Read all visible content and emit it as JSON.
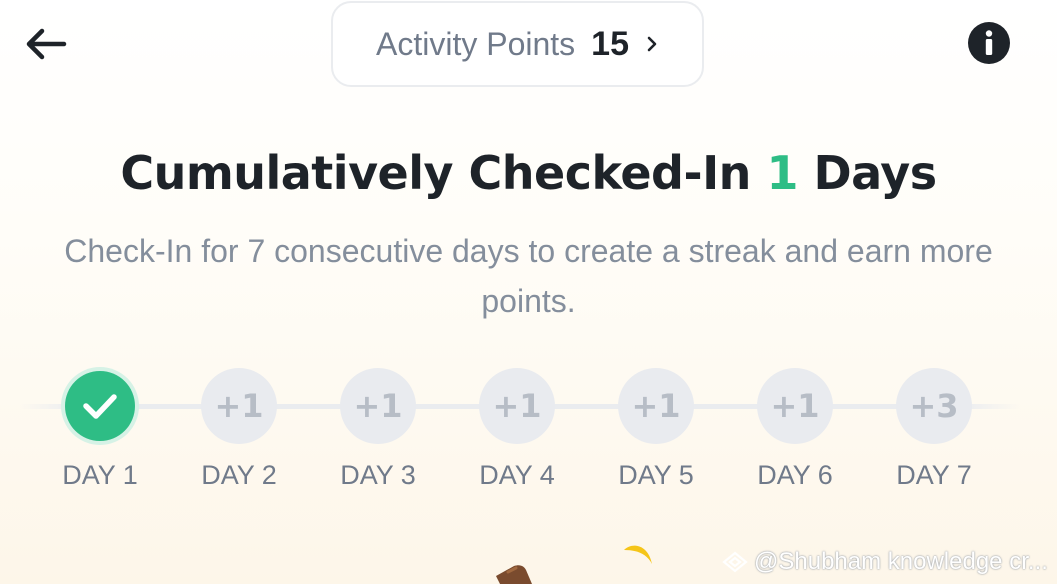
{
  "header": {
    "back_icon": "arrow-left-icon",
    "points_label": "Activity Points",
    "points_value": "15",
    "points_chevron": "›",
    "info_icon": "info-icon"
  },
  "title": {
    "prefix": "Cumulatively Checked-In",
    "count": "1",
    "suffix": "Days"
  },
  "subtitle_line1": "Check-In for 7 consecutive days to create a streak and earn more",
  "subtitle_line2": "points.",
  "days": [
    {
      "label": "DAY 1",
      "reward": "",
      "checked": true
    },
    {
      "label": "DAY 2",
      "reward": "+1",
      "checked": false
    },
    {
      "label": "DAY 3",
      "reward": "+1",
      "checked": false
    },
    {
      "label": "DAY 4",
      "reward": "+1",
      "checked": false
    },
    {
      "label": "DAY 5",
      "reward": "+1",
      "checked": false
    },
    {
      "label": "DAY 6",
      "reward": "+1",
      "checked": false
    },
    {
      "label": "DAY 7",
      "reward": "+3",
      "checked": false
    }
  ],
  "watermark": "@Shubham knowledge cr...",
  "colors": {
    "accent_green": "#2ebd85",
    "text_primary": "#1e2329",
    "text_secondary": "#848e9c",
    "pending_circle": "#e9ebef"
  }
}
